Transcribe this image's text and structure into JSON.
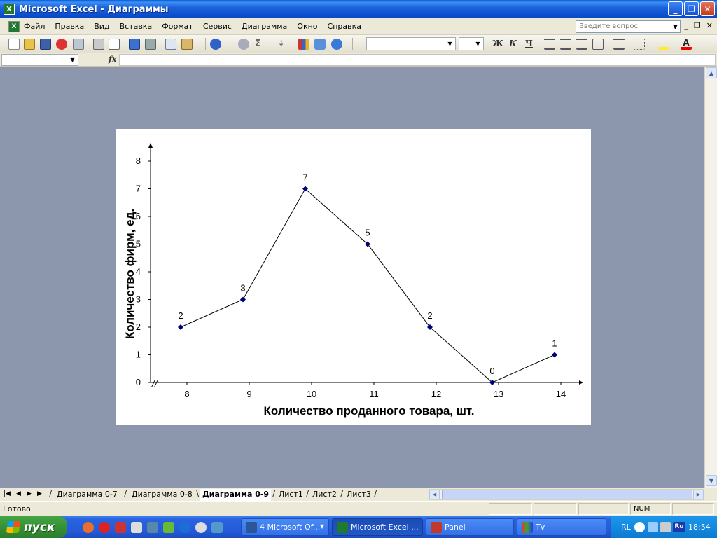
{
  "window": {
    "title": "Microsoft Excel - Диаграммы",
    "app_icon": "X",
    "buttons": {
      "minimize": "_",
      "restore": "❐",
      "close": "✕"
    }
  },
  "menubar": {
    "items": [
      "Файл",
      "Правка",
      "Вид",
      "Вставка",
      "Формат",
      "Сервис",
      "Диаграмма",
      "Окно",
      "Справка"
    ],
    "ask_placeholder": "Введите вопрос",
    "doc_controls": {
      "minimize": "_",
      "restore": "❐",
      "close": "✕"
    }
  },
  "toolbar": {
    "font_value": "",
    "size_value": "",
    "format_buttons": {
      "bold": "Ж",
      "italic": "К",
      "underline": "Ч"
    },
    "icons": [
      "new-icon",
      "open-icon",
      "save-icon",
      "permission-icon",
      "email-icon",
      "print-icon",
      "print-preview-icon",
      "spelling-icon",
      "research-icon",
      "copy-icon",
      "paste-icon",
      "undo-icon",
      "hyperlink-icon",
      "autosum-icon",
      "sort-icon",
      "chart-wizard-icon",
      "drawing-icon",
      "help-icon"
    ]
  },
  "formulabar": {
    "name_box": "",
    "fx_label": "fx",
    "formula": ""
  },
  "chart_data": {
    "type": "line",
    "x": [
      8,
      9,
      10,
      11,
      12,
      13,
      14
    ],
    "categories": [
      "8",
      "9",
      "10",
      "11",
      "12",
      "13",
      "14"
    ],
    "values": [
      2,
      3,
      7,
      5,
      2,
      0,
      1
    ],
    "data_labels": [
      "2",
      "3",
      "7",
      "5",
      "2",
      "0",
      "1"
    ],
    "xlabel": "Количество проданного товара, шт.",
    "ylabel": "Количество фирм, ед.",
    "ylim": [
      0,
      8
    ],
    "yticks": [
      "0",
      "1",
      "2",
      "3",
      "4",
      "5",
      "6",
      "7",
      "8"
    ],
    "grid": false,
    "legend": "none",
    "line_color": "#000000",
    "marker_color": "#00007f",
    "axis_break": "//"
  },
  "sheet_tabs": {
    "tabs": [
      "Диаграмма 0-7",
      "Диаграмма 0-8",
      "Диаграмма 0-9",
      "Лист1",
      "Лист2",
      "Лист3"
    ],
    "active": "Диаграмма 0-9"
  },
  "statusbar": {
    "status": "Готово",
    "num": "NUM"
  },
  "taskbar": {
    "start_label": "пуск",
    "buttons": [
      {
        "label": "4 Microsoft Of...",
        "icon": "word-icon",
        "color": "#2b579a"
      },
      {
        "label": "Microsoft Excel ...",
        "icon": "excel-icon",
        "color": "#1f7a2e"
      },
      {
        "label": "Panel",
        "icon": "panel-icon",
        "color": "#c0392b"
      },
      {
        "label": "Tv",
        "icon": "tv-icon",
        "color": "#6a9c3a"
      }
    ],
    "tray": {
      "lang": "RL",
      "lang2": "Ru",
      "time": "18:54"
    }
  },
  "colors": {
    "workarea_bg": "#8c97ad",
    "titlebar": "#0d4fd0",
    "taskbar": "#245ad7",
    "start_green": "#3a993a"
  }
}
